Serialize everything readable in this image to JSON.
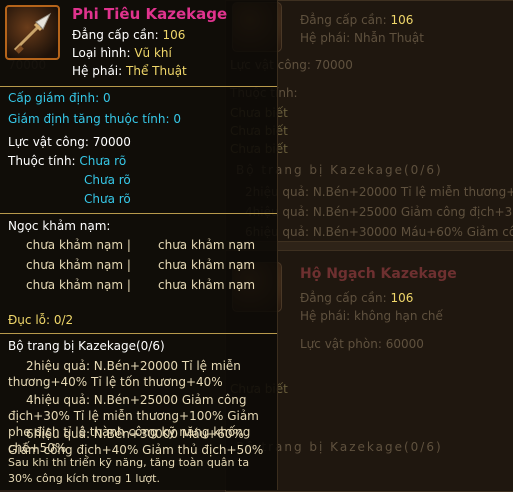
{
  "item": {
    "name": "Phi Tiêu Kazekage",
    "level_label": "Đẳng cấp cần:",
    "level_value": "106",
    "type_label": "Loại hình:",
    "type_value": "Vũ khí",
    "faction_label": "Hệ phái:",
    "faction_value": "Thể Thuật",
    "icon": "kunai-icon"
  },
  "appraisal": {
    "level": "Cấp giám định: 0",
    "attr_bonus": "Giám định tăng thuộc tính: 0"
  },
  "power": {
    "label": "Lực vật công:",
    "value": "70000"
  },
  "attributes": {
    "label": "Thuộc tính:",
    "values": [
      "Chưa rõ",
      "Chưa rõ",
      "Chưa rõ"
    ]
  },
  "gems": {
    "label": "Ngọc khảm nạm:",
    "rows": [
      [
        "chưa khảm nạm |",
        "chưa khảm nạm"
      ],
      [
        "chưa khảm nạm |",
        "chưa khảm nạm"
      ],
      [
        "chưa khảm nạm |",
        "chưa khảm nạm"
      ]
    ],
    "holes": "Đục lỗ: 0/2"
  },
  "set": {
    "title": "Bộ trang bị Kazekage(0/6)",
    "lines": [
      "2hiệu quả: N.Bén+20000 Tỉ lệ miễn thương+40% Tỉ lệ tốn thương+40%",
      "4hiệu quả: N.Bén+25000 Giảm công địch+30% Tỉ lệ miễn thương+100% Giảm phe địch tỉ lệ thành công kỹ năng khống chế+50%",
      "6hiệu quả: N.Bén+30000 Máu+60% Giảm công địch+40% Giảm thủ địch+50%",
      "Sau khi thi triển kỹ năng, tăng toàn quân ta 30% công kích trong 1 lượt."
    ]
  },
  "ghost": {
    "level_label": "Đẳng cấp cần:",
    "level_value": "106",
    "faction_label": "Hệ phái:",
    "faction_value": "Nhẫn Thuật",
    "power": "Lực vật công: 70000",
    "power_left": "70000",
    "attr_label": "Thuộc tính:",
    "unknown": "Chưa biết",
    "set_title": "Bộ trang bị Kazekage(0/6)",
    "set_rows": [
      [
        "2hiệu quả:",
        "N.Bén+20000",
        "Tỉ lệ miễn thương+40"
      ],
      [
        "4hiệu quả:",
        "N.Bén+25000",
        "Giảm công địch+30"
      ],
      [
        "6hiệu quả:",
        "N.Bén+30000",
        "Máu+60% Giảm công"
      ]
    ],
    "left_frag": [
      "N.Bén+20000",
      "N.Bén+25000",
      "N.Bén+30000 Máu+60% Giảm công"
    ],
    "item2_name": "Hộ Ngạch Kazekage",
    "item2_level_label": "Đẳng cấp cần:",
    "item2_level_value": "106",
    "item2_faction_label": "Hệ phái:",
    "item2_faction_value": "không hạn chế",
    "item2_def": "Lực vật phòn: 60000",
    "item2_unknown": "Chưa biết",
    "item2_set": "Bộ trang bị Kazekage(0/6)",
    "left_frag2": [
      "Đẳng cấp cần: 106",
      "Hệ phái: Nhẫn Thuật"
    ],
    "bottom_frag": [
      "hiệu quả: (0/6)",
      "tăng toàn quân ta 30%"
    ]
  }
}
